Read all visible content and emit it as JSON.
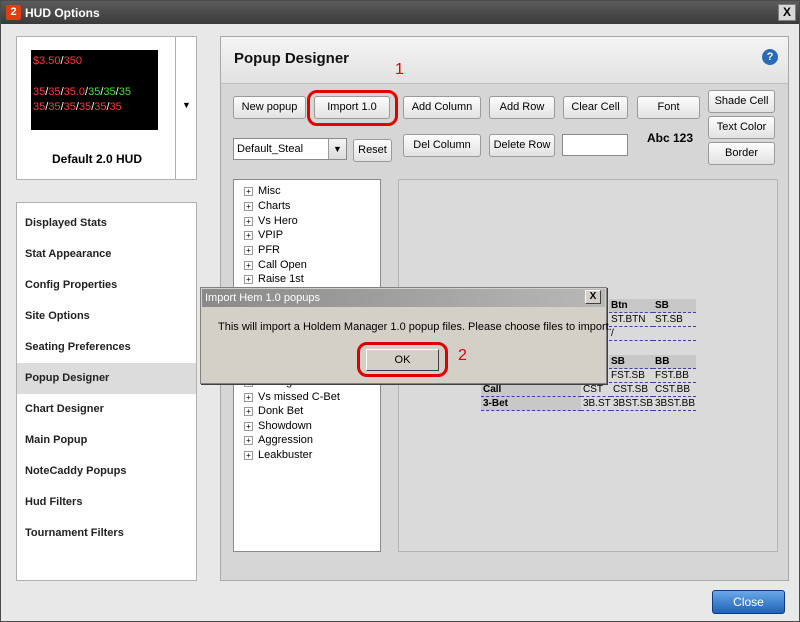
{
  "window": {
    "title": "HUD Options",
    "app_icon_text": "2",
    "close_glyph": "X"
  },
  "hud_preview": {
    "line1": {
      "a": "$3.50",
      "sep": "/",
      "b": "350"
    },
    "line2": [
      "35",
      "/",
      "35",
      "/",
      "35.0",
      "/",
      "35",
      "/",
      "35",
      "/",
      "35"
    ],
    "line3": [
      "35",
      "/",
      "35",
      "/",
      "35",
      "/",
      "35",
      "/",
      "35",
      "/",
      "35"
    ],
    "name": "Default 2.0 HUD",
    "dropdown_glyph": "▼"
  },
  "nav": {
    "items": [
      {
        "label": "Displayed Stats"
      },
      {
        "label": "Stat Appearance"
      },
      {
        "label": "Config Properties"
      },
      {
        "label": "Site Options"
      },
      {
        "label": "Seating Preferences"
      },
      {
        "label": "Popup Designer"
      },
      {
        "label": "Chart Designer"
      },
      {
        "label": "Main Popup"
      },
      {
        "label": "NoteCaddy Popups"
      },
      {
        "label": "Hud Filters"
      },
      {
        "label": "Tournament Filters"
      }
    ],
    "selected": "Popup Designer"
  },
  "panel": {
    "title": "Popup Designer",
    "help_glyph": "?"
  },
  "toolbar": {
    "new_popup": "New popup",
    "import": "Import 1.0",
    "add_column": "Add Column",
    "add_row": "Add Row",
    "clear_cell": "Clear Cell",
    "font": "Font",
    "shade_cell": "Shade Cell",
    "text_color": "Text Color",
    "border": "Border",
    "del_column": "Del Column",
    "delete_row": "Delete Row",
    "reset": "Reset",
    "font_preview": "Abc 123"
  },
  "popup_select": {
    "value": "Default_Steal",
    "arrow": "▼"
  },
  "cell_text": {
    "value": ""
  },
  "tree": {
    "expander": "+",
    "items_top": [
      "Misc",
      "Charts",
      "Vs Hero",
      "VPIP",
      "PFR",
      "Call Open",
      "Raise 1st"
    ],
    "items_bottom": [
      "Betting",
      "Vs missed C-Bet",
      "Donk Bet",
      "Showdown",
      "Aggression",
      "Leakbuster"
    ]
  },
  "grid": {
    "header_top": [
      "Btn",
      "SB"
    ],
    "row_a": [
      "ST.BTN",
      "ST.SB"
    ],
    "row_b_mark": "/",
    "header_mid": [
      "SB",
      "BB"
    ],
    "row_c": [
      "FST.SB",
      "FST.BB"
    ],
    "call_row": {
      "label": "Call",
      "cells": [
        "CST",
        "CST.SB",
        "CST.BB"
      ]
    },
    "threebet_row": {
      "label": "3-Bet",
      "cells": [
        "3B.ST",
        "3BST.SB",
        "3BST.BB"
      ]
    }
  },
  "dialog": {
    "title": "Import Hem 1.0 popups",
    "close_glyph": "X",
    "message": "This will import a Holdem Manager 1.0 popup files. Please choose files to import.",
    "ok": "OK"
  },
  "annotations": {
    "step1": "1",
    "step2": "2",
    "color": "#e00000"
  },
  "footer": {
    "close": "Close"
  }
}
